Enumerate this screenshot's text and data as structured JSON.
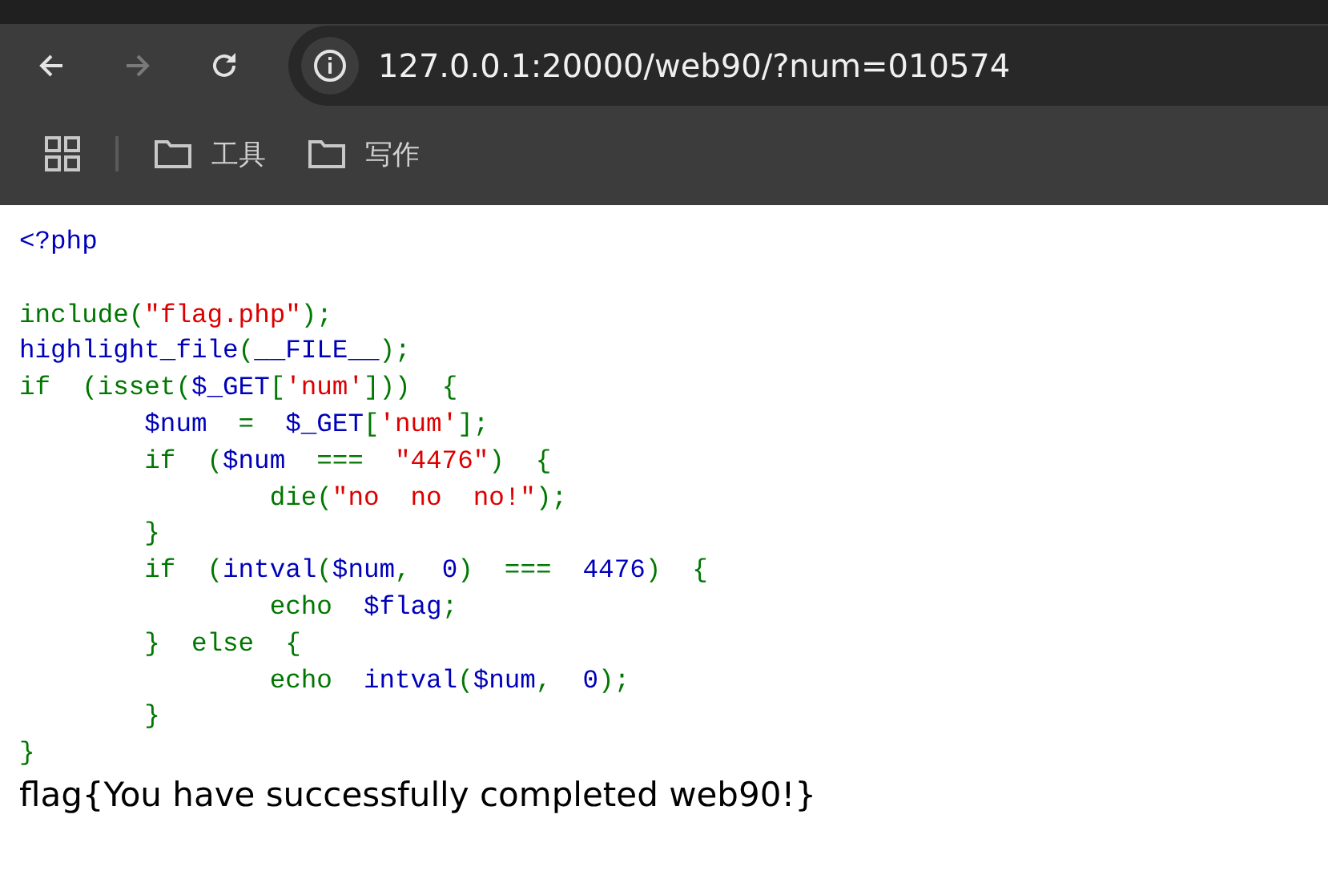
{
  "browser": {
    "url": "127.0.0.1:20000/web90/?num=010574",
    "back_disabled": false,
    "forward_disabled": true,
    "bookmarks": [
      {
        "label": "工具"
      },
      {
        "label": "写作"
      }
    ]
  },
  "code_lines": [
    {
      "kind": "code",
      "tokens": [
        {
          "kind": "default",
          "text": "<?php"
        }
      ]
    },
    {
      "kind": "blank"
    },
    {
      "kind": "code",
      "tokens": [
        {
          "kind": "keyword",
          "text": "include("
        },
        {
          "kind": "string",
          "text": "\"flag.php\""
        },
        {
          "kind": "keyword",
          "text": ");"
        }
      ]
    },
    {
      "kind": "code",
      "tokens": [
        {
          "kind": "default",
          "text": "highlight_file"
        },
        {
          "kind": "keyword",
          "text": "("
        },
        {
          "kind": "default",
          "text": "__FILE__"
        },
        {
          "kind": "keyword",
          "text": ");"
        }
      ]
    },
    {
      "kind": "code",
      "tokens": [
        {
          "kind": "keyword",
          "text": "if  (isset("
        },
        {
          "kind": "default",
          "text": "$_GET"
        },
        {
          "kind": "keyword",
          "text": "["
        },
        {
          "kind": "string",
          "text": "'num'"
        },
        {
          "kind": "keyword",
          "text": "]))  {"
        }
      ]
    },
    {
      "kind": "code",
      "tokens": [
        {
          "kind": "default",
          "text": "        $num  "
        },
        {
          "kind": "keyword",
          "text": "=  "
        },
        {
          "kind": "default",
          "text": "$_GET"
        },
        {
          "kind": "keyword",
          "text": "["
        },
        {
          "kind": "string",
          "text": "'num'"
        },
        {
          "kind": "keyword",
          "text": "];"
        }
      ]
    },
    {
      "kind": "code",
      "tokens": [
        {
          "kind": "keyword",
          "text": "        if  ("
        },
        {
          "kind": "default",
          "text": "$num  "
        },
        {
          "kind": "keyword",
          "text": "===  "
        },
        {
          "kind": "string",
          "text": "\"4476\""
        },
        {
          "kind": "keyword",
          "text": ")  {"
        }
      ]
    },
    {
      "kind": "code",
      "tokens": [
        {
          "kind": "keyword",
          "text": "                die("
        },
        {
          "kind": "string",
          "text": "\"no  no  no!\""
        },
        {
          "kind": "keyword",
          "text": ");"
        }
      ]
    },
    {
      "kind": "code",
      "tokens": [
        {
          "kind": "keyword",
          "text": "        }"
        }
      ]
    },
    {
      "kind": "code",
      "tokens": [
        {
          "kind": "keyword",
          "text": "        if  ("
        },
        {
          "kind": "default",
          "text": "intval"
        },
        {
          "kind": "keyword",
          "text": "("
        },
        {
          "kind": "default",
          "text": "$num"
        },
        {
          "kind": "keyword",
          "text": ",  "
        },
        {
          "kind": "default",
          "text": "0"
        },
        {
          "kind": "keyword",
          "text": ")  ===  "
        },
        {
          "kind": "default",
          "text": "4476"
        },
        {
          "kind": "keyword",
          "text": ")  {"
        }
      ]
    },
    {
      "kind": "code",
      "tokens": [
        {
          "kind": "keyword",
          "text": "                echo  "
        },
        {
          "kind": "default",
          "text": "$flag"
        },
        {
          "kind": "keyword",
          "text": ";"
        }
      ]
    },
    {
      "kind": "code",
      "tokens": [
        {
          "kind": "keyword",
          "text": "        }  else  {"
        }
      ]
    },
    {
      "kind": "code",
      "tokens": [
        {
          "kind": "keyword",
          "text": "                echo  "
        },
        {
          "kind": "default",
          "text": "intval"
        },
        {
          "kind": "keyword",
          "text": "("
        },
        {
          "kind": "default",
          "text": "$num"
        },
        {
          "kind": "keyword",
          "text": ",  "
        },
        {
          "kind": "default",
          "text": "0"
        },
        {
          "kind": "keyword",
          "text": ");"
        }
      ]
    },
    {
      "kind": "code",
      "tokens": [
        {
          "kind": "keyword",
          "text": "        }"
        }
      ]
    },
    {
      "kind": "code",
      "tokens": [
        {
          "kind": "keyword",
          "text": "}"
        }
      ]
    }
  ],
  "output": "flag{You have successfully completed web90!}"
}
